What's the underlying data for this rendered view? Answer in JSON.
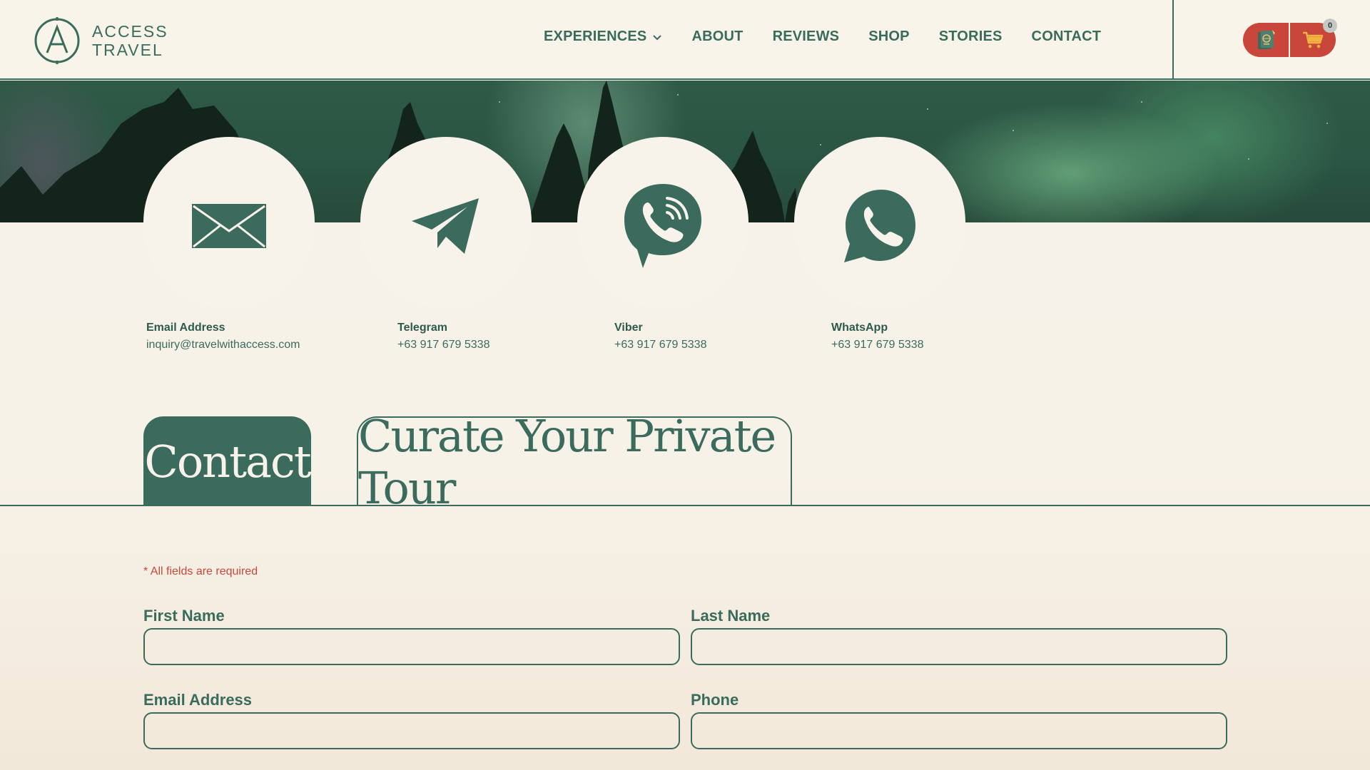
{
  "brand": {
    "line1": "ACCESS",
    "line2": "TRAVEL"
  },
  "nav": [
    {
      "label": "EXPERIENCES"
    },
    {
      "label": "ABOUT"
    },
    {
      "label": "REVIEWS"
    },
    {
      "label": "SHOP"
    },
    {
      "label": "STORIES"
    },
    {
      "label": "CONTACT"
    }
  ],
  "cart": {
    "count": "0"
  },
  "contact_methods": [
    {
      "label": "Email Address",
      "value": "inquiry@travelwithaccess.com",
      "icon": "envelope-icon"
    },
    {
      "label": "Telegram",
      "value": "+63 917 679 5338",
      "icon": "telegram-icon"
    },
    {
      "label": "Viber",
      "value": "+63 917 679 5338",
      "icon": "viber-icon"
    },
    {
      "label": "WhatsApp",
      "value": "+63 917 679 5338",
      "icon": "whatsapp-icon"
    }
  ],
  "tabs": {
    "contact": "Contact",
    "curate": "Curate Your Private Tour"
  },
  "form": {
    "required_note": "* All fields are required",
    "first_name": "First Name",
    "last_name": "Last Name",
    "email": "Email Address",
    "phone": "Phone"
  },
  "colors": {
    "primary": "#3b6b5d",
    "accent": "#c9473a",
    "background": "#f7f3ea"
  }
}
